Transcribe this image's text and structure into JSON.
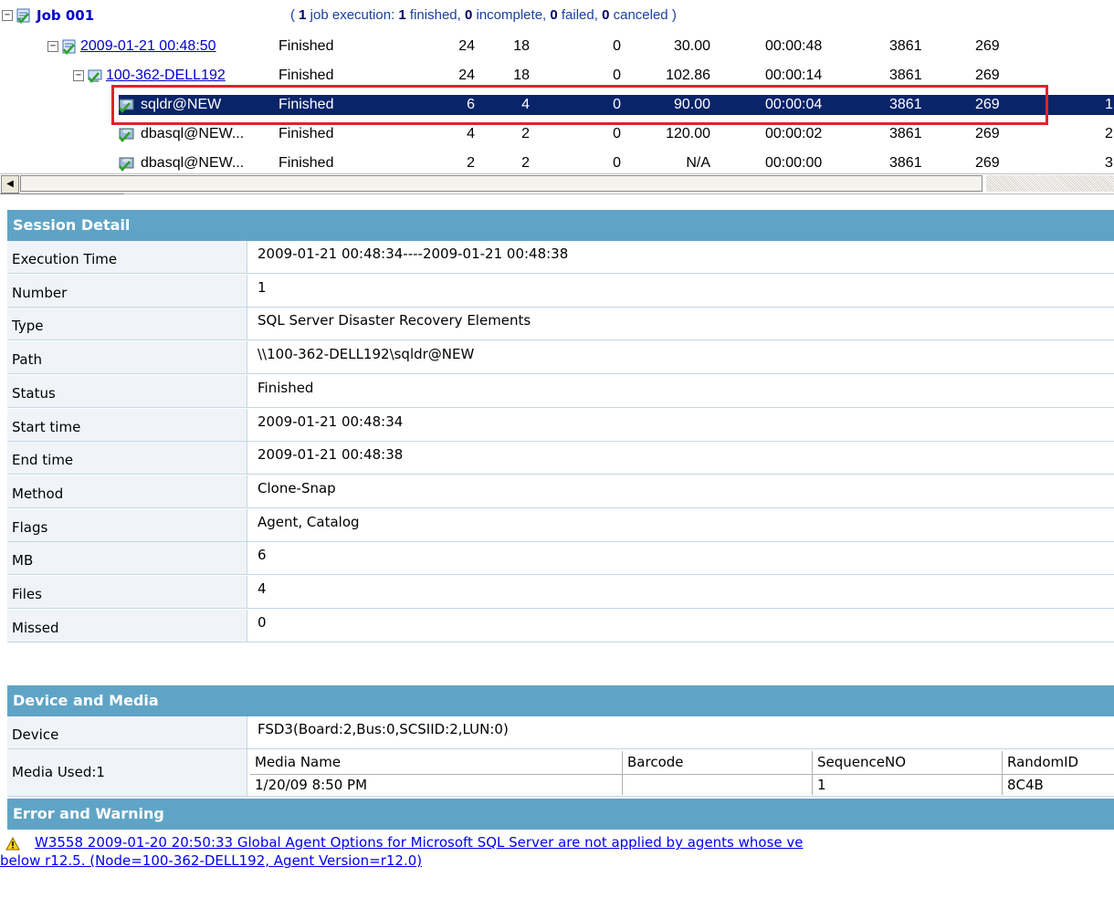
{
  "job": {
    "title": "Job 001",
    "summary_open": "( ",
    "exec_count": "1",
    "exec_text": " job execution: ",
    "finished_count": "1",
    "finished_text": " finished, ",
    "incomplete_count": "0",
    "incomplete_text": " incomplete, ",
    "failed_count": "0",
    "failed_text": " failed, ",
    "canceled_count": "0",
    "canceled_text": " canceled )"
  },
  "rows": [
    {
      "name": "2009-01-21 00:48:50",
      "status": "Finished",
      "c1": "24",
      "c2": "18",
      "c3": "0",
      "c4": "30.00",
      "c5": "00:00:48",
      "c6": "3861",
      "c7": "269",
      "c8": ""
    },
    {
      "name": "100-362-DELL192",
      "status": "Finished",
      "c1": "24",
      "c2": "18",
      "c3": "0",
      "c4": "102.86",
      "c5": "00:00:14",
      "c6": "3861",
      "c7": "269",
      "c8": ""
    },
    {
      "name": "sqldr@NEW",
      "status": "Finished",
      "c1": "6",
      "c2": "4",
      "c3": "0",
      "c4": "90.00",
      "c5": "00:00:04",
      "c6": "3861",
      "c7": "269",
      "c8": "1"
    },
    {
      "name": "dbasql@NEW...",
      "status": "Finished",
      "c1": "4",
      "c2": "2",
      "c3": "0",
      "c4": "120.00",
      "c5": "00:00:02",
      "c6": "3861",
      "c7": "269",
      "c8": "2"
    },
    {
      "name": "dbasql@NEW...",
      "status": "Finished",
      "c1": "2",
      "c2": "2",
      "c3": "0",
      "c4": "N/A",
      "c5": "00:00:00",
      "c6": "3861",
      "c7": "269",
      "c8": "3"
    }
  ],
  "session": {
    "header": "Session Detail",
    "items": [
      {
        "label": "Execution Time",
        "value": "2009-01-21 00:48:34----2009-01-21 00:48:38"
      },
      {
        "label": "Number",
        "value": "1"
      },
      {
        "label": "Type",
        "value": "SQL Server Disaster Recovery Elements"
      },
      {
        "label": "Path",
        "value": "\\\\100-362-DELL192\\sqldr@NEW"
      },
      {
        "label": "Status",
        "value": "Finished"
      },
      {
        "label": "Start time",
        "value": "2009-01-21 00:48:34"
      },
      {
        "label": "End time",
        "value": "2009-01-21 00:48:38"
      },
      {
        "label": "Method",
        "value": "Clone-Snap"
      },
      {
        "label": "Flags",
        "value": "Agent, Catalog"
      },
      {
        "label": "MB",
        "value": "6"
      },
      {
        "label": "Files",
        "value": "4"
      },
      {
        "label": "Missed",
        "value": "0"
      }
    ]
  },
  "device": {
    "header": "Device and Media",
    "device_label": "Device",
    "device_value": "FSD3(Board:2,Bus:0,SCSIID:2,LUN:0)",
    "media_label": "Media Used:1",
    "media_headers": [
      "Media Name",
      "Barcode",
      "SequenceNO",
      "RandomID"
    ],
    "media_values": [
      "1/20/09 8:50 PM",
      "",
      "1",
      "8C4B"
    ]
  },
  "errors": {
    "header": "Error and Warning",
    "line1": "W3558 2009-01-20 20:50:33 Global Agent Options for Microsoft SQL Server are not applied by agents whose ve",
    "line2": "below r12.5. (Node=100-362-DELL192, Agent Version=r12.0)"
  },
  "colors": {
    "section_header": "#5fa4c6",
    "selection": "#0a246a",
    "highlight_box": "#d9262b",
    "link": "#0000ee"
  }
}
